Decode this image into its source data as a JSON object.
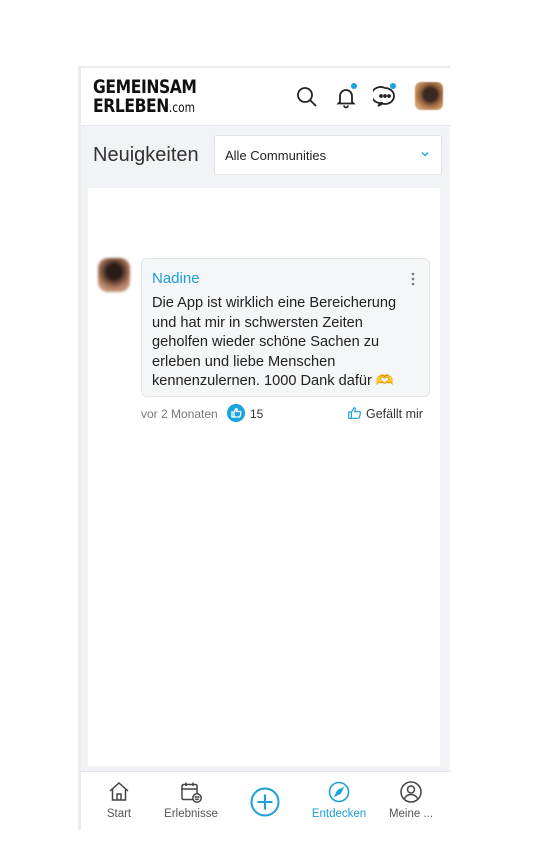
{
  "header": {
    "logo_line1": "GEMEINSAM",
    "logo_line2": "ERLEBEN",
    "logo_domain": ".com",
    "icons": [
      "search-icon",
      "bell-icon",
      "chat-icon",
      "avatar"
    ]
  },
  "subheader": {
    "title": "Neuigkeiten",
    "filter_value": "Alle Communities"
  },
  "post": {
    "author": "Nadine",
    "text": "Die App ist wirklich eine Bereicherung und hat mir in schwersten Zeiten geholfen wieder schöne Sachen zu erleben und liebe Menschen kennenzulernen. 1000 Dank dafür 🫶",
    "time": "vor 2 Monaten",
    "like_count": "15",
    "like_label": "Gefällt mir"
  },
  "nav": {
    "items": [
      {
        "label": "Start",
        "icon": "home-icon"
      },
      {
        "label": "Erlebnisse",
        "icon": "calendar-icon"
      },
      {
        "label": "",
        "icon": "add-icon"
      },
      {
        "label": "Entdecken",
        "icon": "compass-icon"
      },
      {
        "label": "Meine ...",
        "icon": "user-icon"
      }
    ]
  },
  "colors": {
    "accent": "#1a9fd9",
    "background": "#f2f3f6",
    "notification_dot": "#19a6e0"
  }
}
